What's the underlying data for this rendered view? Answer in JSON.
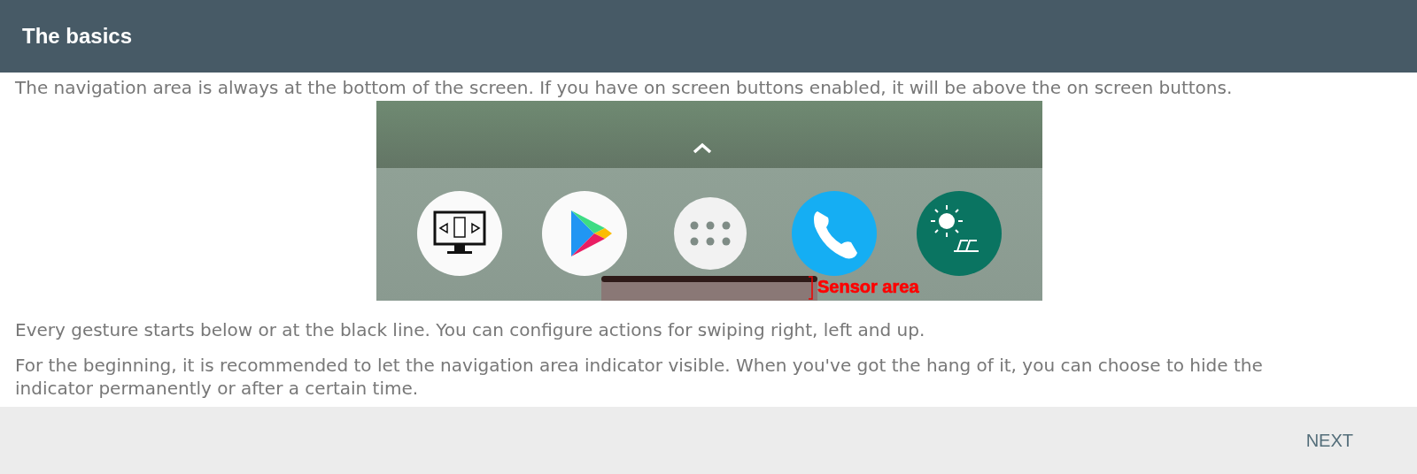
{
  "header": {
    "title": "The basics"
  },
  "paragraphs_top": [
    "The navigation area is always at the bottom of the screen. If you have on screen buttons enabled, it will be above the on screen buttons."
  ],
  "illustration": {
    "annotation": "Sensor area"
  },
  "paragraphs_bottom": [
    "Every gesture starts below or at the black line. You can configure actions for swiping right, left and up.",
    "For the beginning, it is recommended to let the navigation area indicator visible. When you've got the hang of it, you can choose to hide the indicator permanently or after a certain time."
  ],
  "footer": {
    "button": "NEXT"
  }
}
